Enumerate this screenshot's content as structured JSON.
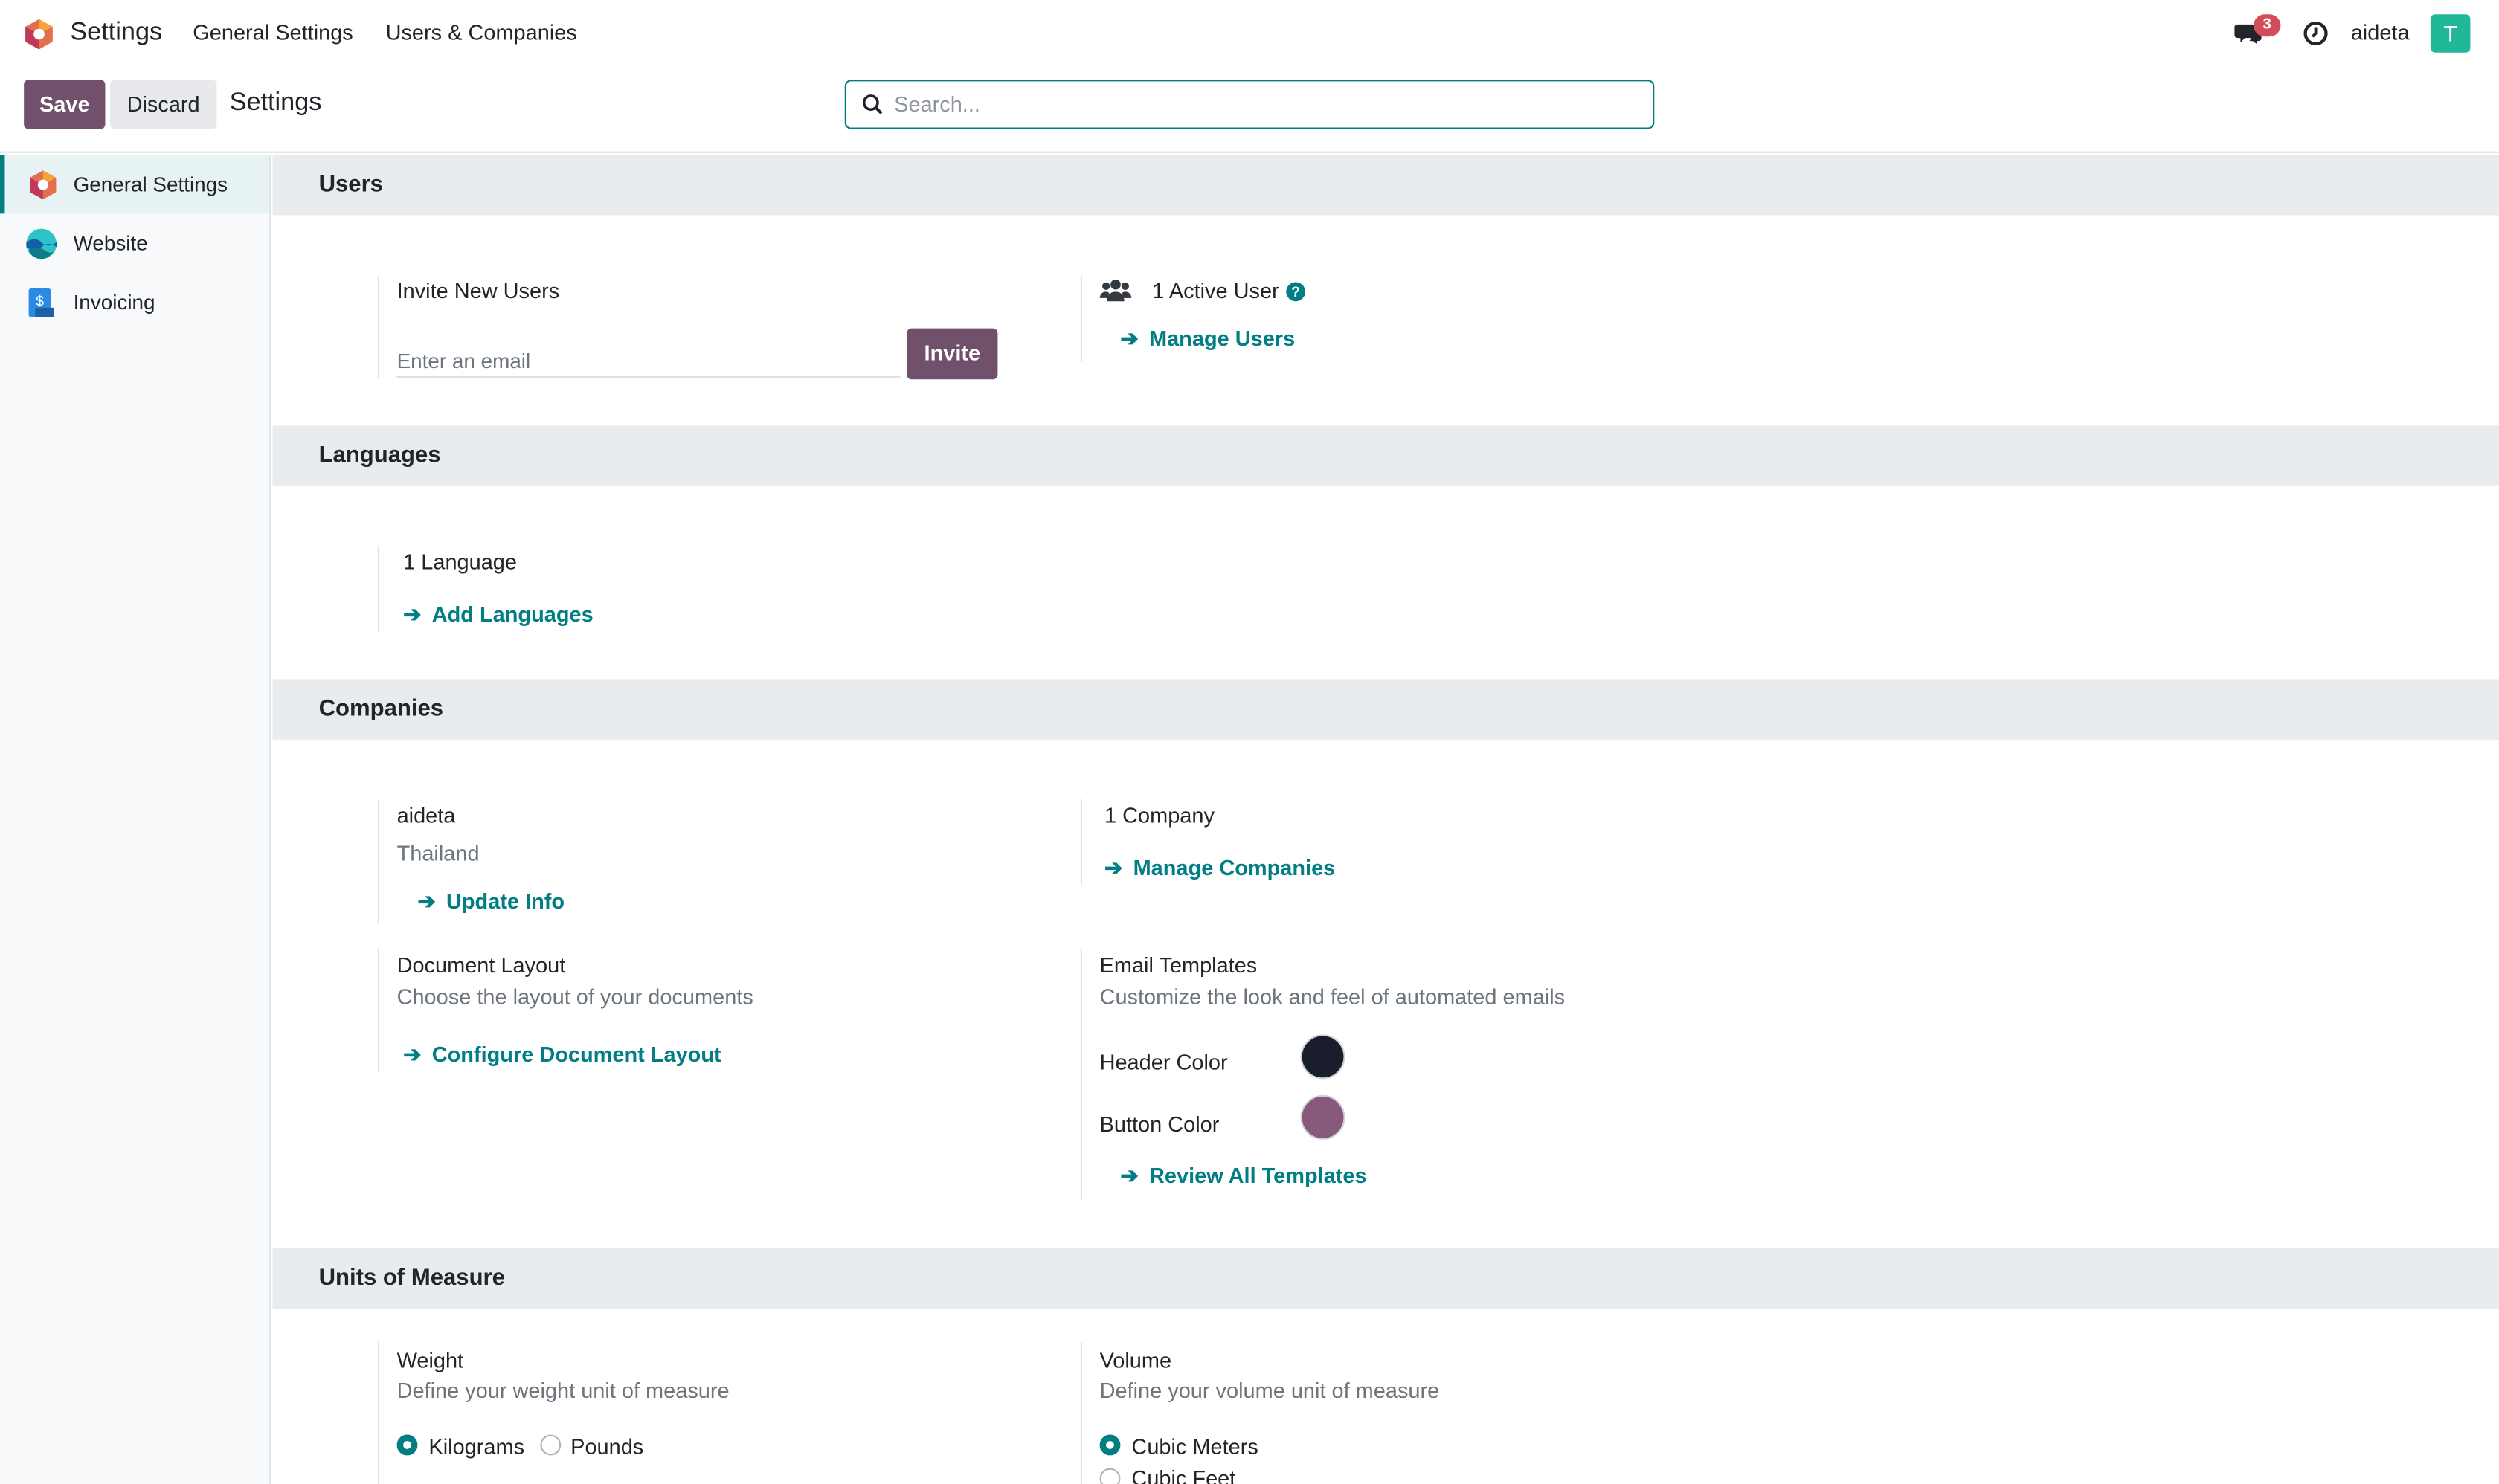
{
  "topbar": {
    "app_name": "Settings",
    "menu": [
      "General Settings",
      "Users & Companies"
    ],
    "chat_badge": "3",
    "username": "aideta",
    "avatar_letter": "T"
  },
  "control": {
    "save_label": "Save",
    "discard_label": "Discard",
    "title": "Settings",
    "search_placeholder": "Search..."
  },
  "sidebar": {
    "items": [
      {
        "label": "General Settings",
        "icon": "settings-app-icon",
        "active": true
      },
      {
        "label": "Website",
        "icon": "website-app-icon",
        "active": false
      },
      {
        "label": "Invoicing",
        "icon": "invoicing-app-icon",
        "active": false
      }
    ]
  },
  "users": {
    "title": "Users",
    "invite_label": "Invite New Users",
    "email_placeholder": "Enter an email",
    "invite_button": "Invite",
    "active_users": "1 Active User",
    "manage_users": "Manage Users"
  },
  "languages": {
    "title": "Languages",
    "count": "1 Language",
    "add_languages": "Add Languages"
  },
  "companies": {
    "title": "Companies",
    "company_name": "aideta",
    "company_country": "Thailand",
    "update_info": "Update Info",
    "company_count": "1 Company",
    "manage_companies": "Manage Companies",
    "doc_layout_title": "Document Layout",
    "doc_layout_desc": "Choose the layout of your documents",
    "configure_doc_layout": "Configure Document Layout",
    "email_templates_title": "Email Templates",
    "email_templates_desc": "Customize the look and feel of automated emails",
    "header_color_label": "Header Color",
    "header_color": "#1a1d2b",
    "button_color_label": "Button Color",
    "button_color": "#875a7b",
    "review_templates": "Review All Templates"
  },
  "uom": {
    "title": "Units of Measure",
    "weight_title": "Weight",
    "weight_desc": "Define your weight unit of measure",
    "weight_options": [
      "Kilograms",
      "Pounds"
    ],
    "weight_selected": "Kilograms",
    "volume_title": "Volume",
    "volume_desc": "Define your volume unit of measure",
    "volume_options": [
      "Cubic Meters",
      "Cubic Feet"
    ],
    "volume_selected": "Cubic Meters"
  },
  "colors": {
    "brand": "#71506b",
    "accent": "#017e84",
    "section_bg": "#e9ecef"
  }
}
